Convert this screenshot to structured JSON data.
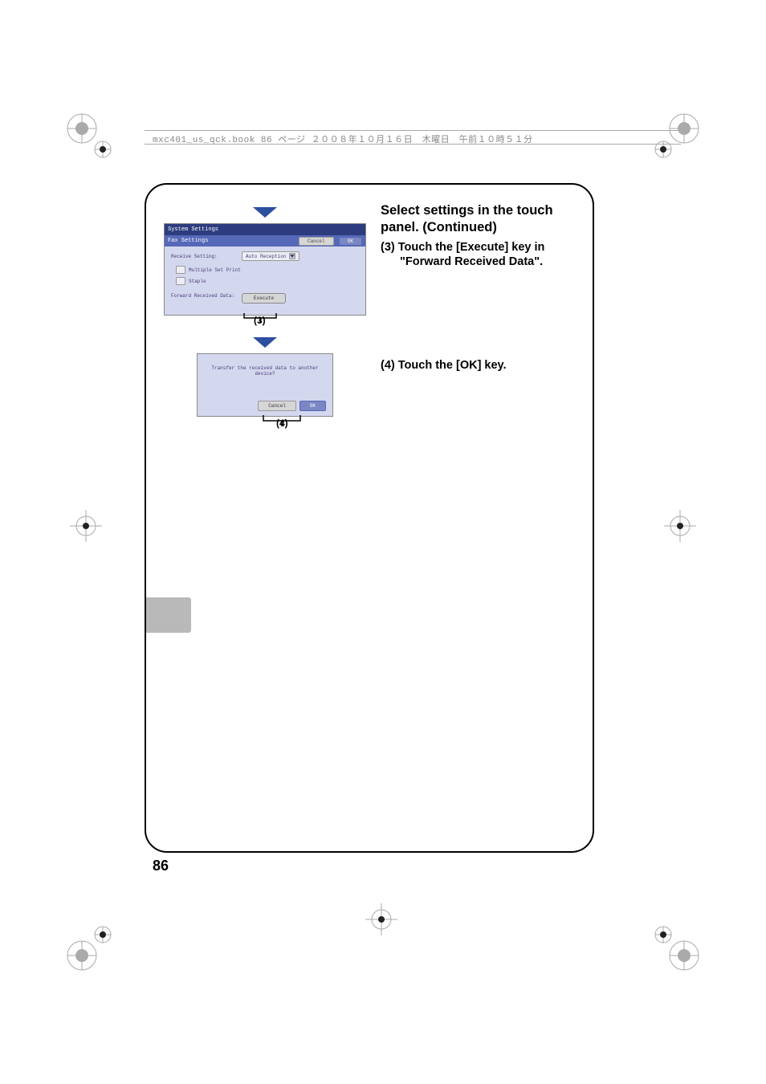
{
  "header": {
    "text": "mxc401_us_qck.book  86 ページ  ２００８年１０月１６日　木曜日　午前１０時５１分"
  },
  "page_number": "86",
  "instructions": {
    "title_line1": "Select settings in the touch",
    "title_line2": "panel. (Continued)",
    "step3_prefix": "(3)",
    "step3_line1": "Touch the [Execute] key in",
    "step3_line2": "\"Forward Received Data\".",
    "step4_prefix": "(4)",
    "step4_line1": "Touch the [OK] key."
  },
  "screen1": {
    "title": "System Settings",
    "section": "Fax Settings",
    "cancel": "Cancel",
    "ok": "OK",
    "receive_label": "Receive Setting:",
    "receive_value": "Auto Reception",
    "multiple": "Multiple Set Print",
    "staple": "Staple",
    "forward_label": "Forward Received Data:",
    "execute": "Execute",
    "callout": "(3)"
  },
  "dialog": {
    "text": "Transfer the received data to another device?",
    "cancel": "Cancel",
    "ok": "OK",
    "callout": "(4)"
  }
}
